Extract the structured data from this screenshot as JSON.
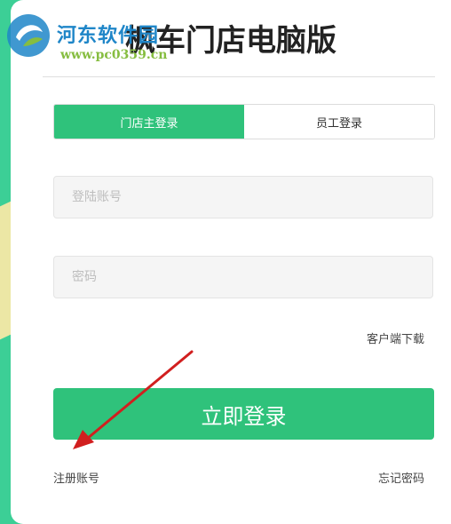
{
  "app": {
    "title": "枫车门店电脑版"
  },
  "watermark": {
    "site_name": "河东软件园",
    "url": "www.pc0359.cn"
  },
  "tabs": [
    {
      "label": "门店主登录",
      "active": true
    },
    {
      "label": "员工登录",
      "active": false
    }
  ],
  "form": {
    "account_placeholder": "登陆账号",
    "password_placeholder": "密码"
  },
  "links": {
    "download": "客户端下载",
    "register": "注册账号",
    "forgot": "忘记密码"
  },
  "login_button": {
    "label": "立即登录"
  },
  "colors": {
    "brand": "#2fc27b",
    "background": "#3ccf96",
    "annotation_arrow": "#d11f1f"
  }
}
